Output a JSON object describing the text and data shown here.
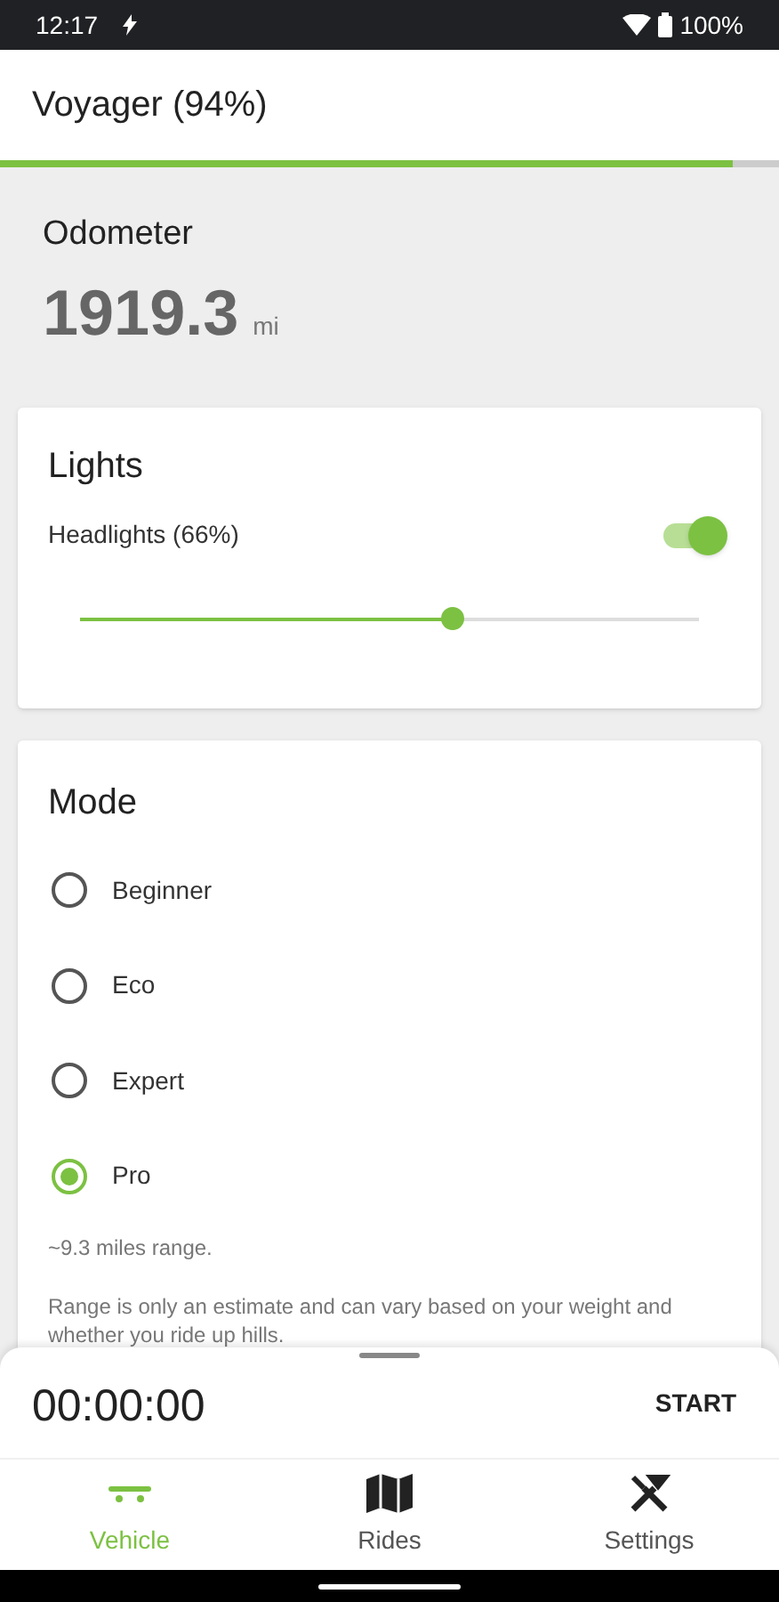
{
  "status_bar": {
    "time": "12:17",
    "battery": "100%"
  },
  "header": {
    "title": "Voyager (94%)",
    "level": 0.94
  },
  "odometer": {
    "label": "Odometer",
    "value": "1919.3",
    "unit": "mi"
  },
  "lights": {
    "title": "Lights",
    "label": "Headlights (66%)",
    "on": true,
    "level": 0.6
  },
  "mode": {
    "title": "Mode",
    "options": [
      {
        "label": "Beginner",
        "selected": false
      },
      {
        "label": "Eco",
        "selected": false
      },
      {
        "label": "Expert",
        "selected": false
      },
      {
        "label": "Pro",
        "selected": true
      }
    ],
    "range": "~9.3 miles range.",
    "note": "Range is only an estimate and can vary based on your weight and whether you ride up hills."
  },
  "timer": {
    "time": "00:00:00",
    "button": "START"
  },
  "nav": [
    {
      "label": "Vehicle",
      "kind": "vehicle",
      "selected": true
    },
    {
      "label": "Rides",
      "kind": "rides",
      "selected": false
    },
    {
      "label": "Settings",
      "kind": "settings",
      "selected": false
    }
  ]
}
